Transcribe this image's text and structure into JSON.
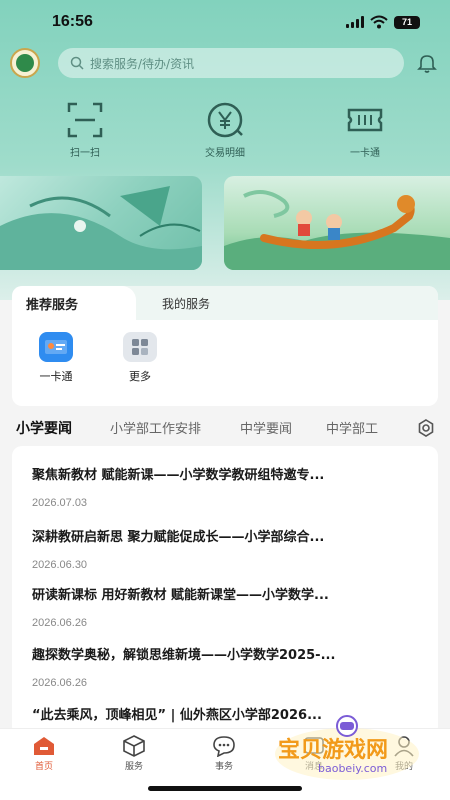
{
  "status_bar": {
    "time": "16:56",
    "battery": "71"
  },
  "search": {
    "placeholder": "搜索服务/待办/资讯"
  },
  "quick_actions": [
    {
      "label": "扫一扫",
      "icon": "scan-icon"
    },
    {
      "label": "交易明细",
      "icon": "yuan-icon"
    },
    {
      "label": "一卡通",
      "icon": "card-ticket-icon"
    }
  ],
  "services_card": {
    "tabs": [
      "推荐服务",
      "我的服务"
    ],
    "items": [
      {
        "label": "一卡通",
        "icon": "id-card-icon"
      },
      {
        "label": "更多",
        "icon": "grid-more-icon"
      }
    ]
  },
  "news_tabs": [
    "小学要闻",
    "小学部工作安排",
    "中学要闻",
    "中学部工"
  ],
  "news": [
    {
      "title": "聚焦新教材 赋能新课——小学数学教研组特邀专...",
      "date": "2026.07.03"
    },
    {
      "title": "深耕教研启新思 聚力赋能促成长——小学部综合...",
      "date": "2026.06.30"
    },
    {
      "title": "研读新课标 用好新教材 赋能新课堂——小学数学...",
      "date": "2026.06.26"
    },
    {
      "title": "趣探数学奥秘，解锁思维新境——小学数学2025-...",
      "date": "2026.06.26"
    },
    {
      "title": "“此去乘风，顶峰相见” | 仙外燕区小学部2026...",
      "date": ""
    }
  ],
  "bottom_nav": [
    {
      "label": "首页",
      "icon": "home-icon",
      "active": true
    },
    {
      "label": "服务",
      "icon": "cube-icon",
      "active": false
    },
    {
      "label": "事务",
      "icon": "chat-icon",
      "active": false
    },
    {
      "label": "消息",
      "icon": "message-icon",
      "active": false
    },
    {
      "label": "我的",
      "icon": "user-icon",
      "active": false
    }
  ],
  "watermark": {
    "title": "宝贝游戏网",
    "url": "baobeiy.com"
  },
  "colors": {
    "accent": "#82d2bd",
    "active_tab": "#e05a36",
    "card_blue": "#2f8cf0"
  }
}
